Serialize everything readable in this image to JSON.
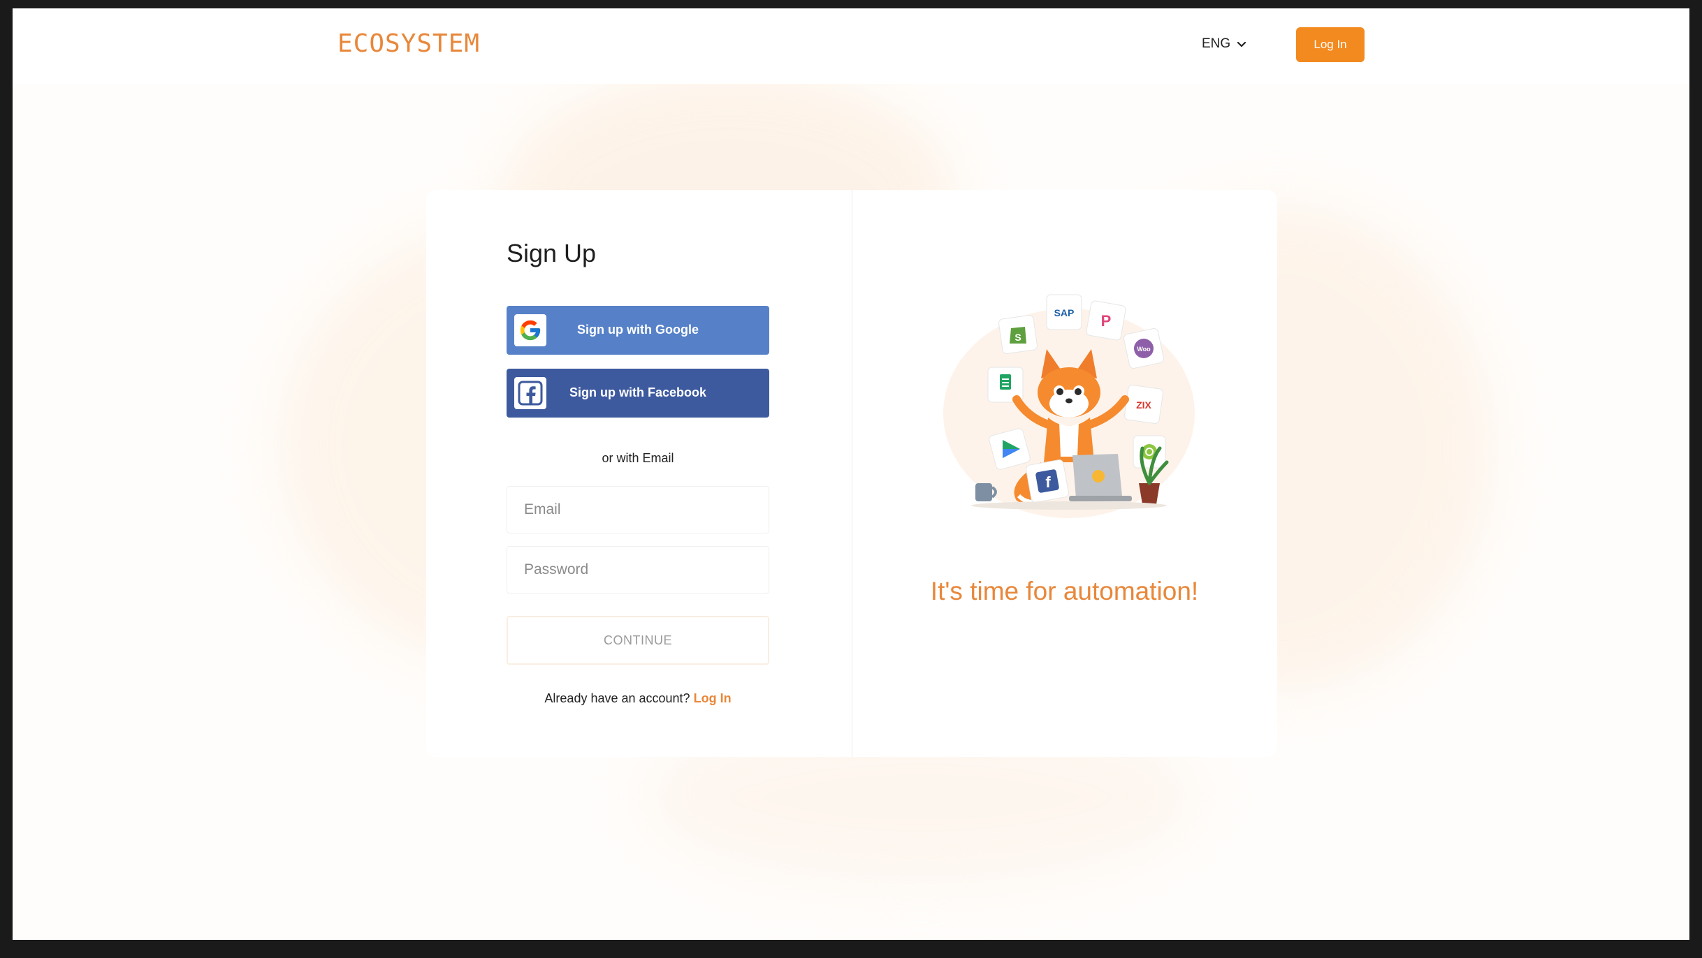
{
  "header": {
    "logo": "ECOSYSTEM",
    "language": "ENG",
    "login_label": "Log In"
  },
  "signup": {
    "title": "Sign Up",
    "google_label": "Sign up with Google",
    "facebook_label": "Sign up with Facebook",
    "or_email": "or with Email",
    "email_placeholder": "Email",
    "password_placeholder": "Password",
    "continue_label": "CONTINUE",
    "already_text": "Already have an account?",
    "login_link": "Log In"
  },
  "promo": {
    "tagline": "It's time for automation!"
  },
  "colors": {
    "accent": "#f38a1f",
    "google_button": "#5681c8",
    "facebook_button": "#3d5a9e"
  }
}
